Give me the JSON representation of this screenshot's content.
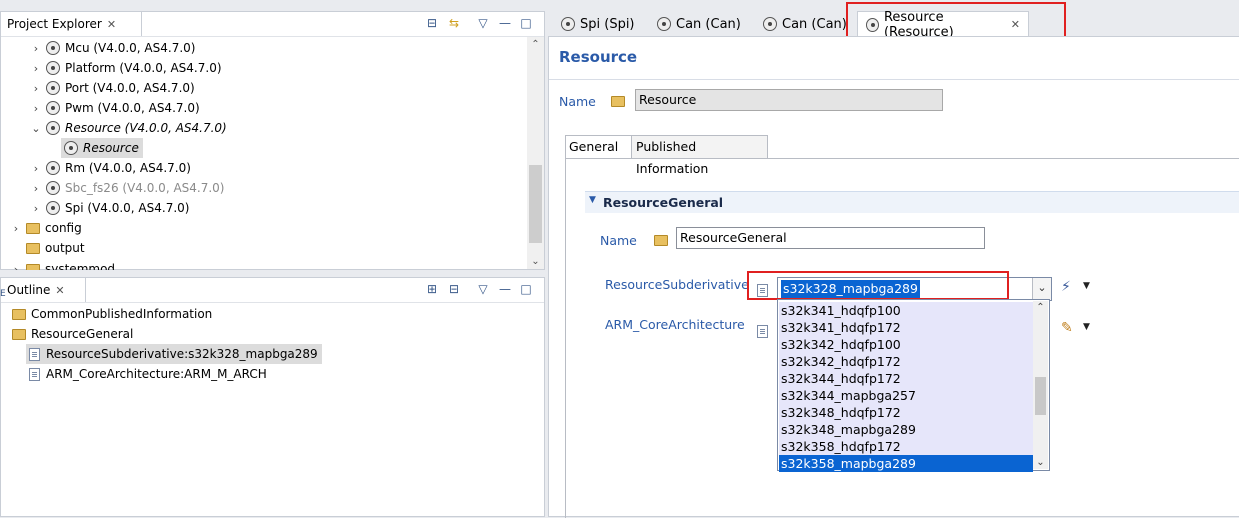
{
  "project_explorer": {
    "tab_label": "Project Explorer",
    "tree": [
      {
        "label": "Mcu (V4.0.0, AS4.7.0)",
        "icon": "module-icon",
        "style": "normal"
      },
      {
        "label": "Platform (V4.0.0, AS4.7.0)",
        "icon": "module-icon",
        "style": "normal"
      },
      {
        "label": "Port (V4.0.0, AS4.7.0)",
        "icon": "module-icon",
        "style": "normal"
      },
      {
        "label": "Pwm (V4.0.0, AS4.7.0)",
        "icon": "module-icon",
        "style": "normal"
      },
      {
        "label": "Resource (V4.0.0, AS4.7.0)",
        "icon": "module-icon",
        "style": "italic"
      },
      {
        "label": "Resource",
        "icon": "module-icon",
        "style": "italic"
      },
      {
        "label": "Rm (V4.0.0, AS4.7.0)",
        "icon": "module-icon",
        "style": "normal"
      },
      {
        "label": "Sbc_fs26 (V4.0.0, AS4.7.0)",
        "icon": "module-icon",
        "style": "grey"
      },
      {
        "label": "Spi (V4.0.0, AS4.7.0)",
        "icon": "module-icon",
        "style": "normal"
      },
      {
        "label": "config",
        "icon": "folder-icon",
        "style": "normal"
      },
      {
        "label": "output",
        "icon": "folder-icon",
        "style": "normal"
      },
      {
        "label": "systemmod",
        "icon": "folder-icon",
        "style": "normal"
      }
    ]
  },
  "outline": {
    "tab_label": "Outline",
    "items": [
      {
        "label": "CommonPublishedInformation",
        "icon": "folder-icon"
      },
      {
        "label": "ResourceGeneral",
        "icon": "folder-icon"
      },
      {
        "label": "ResourceSubderivative:s32k328_mapbga289",
        "icon": "document-icon"
      },
      {
        "label": "ARM_CoreArchitecture:ARM_M_ARCH",
        "icon": "document-icon"
      }
    ]
  },
  "editor_tabs": [
    {
      "label": "Spi (Spi)"
    },
    {
      "label": "Can (Can)"
    },
    {
      "label": "Can (Can)"
    },
    {
      "label": "Resource (Resource)"
    }
  ],
  "editor": {
    "title": "Resource",
    "name_label": "Name",
    "name_value": "Resource",
    "subtabs": [
      "General",
      "Published Information"
    ],
    "section_title": "ResourceGeneral",
    "section_name_label": "Name",
    "section_name_value": "ResourceGeneral",
    "subderivative_label": "ResourceSubderivative",
    "subderivative_value": "s32k328_mapbga289",
    "core_arch_label": "ARM_CoreArchitecture",
    "dropdown_options": [
      "s32k341_hdqfp100",
      "s32k341_hdqfp172",
      "s32k342_hdqfp100",
      "s32k342_hdqfp172",
      "s32k344_hdqfp172",
      "s32k344_mapbga257",
      "s32k348_hdqfp172",
      "s32k348_mapbga289",
      "s32k358_hdqfp172",
      "s32k358_mapbga289"
    ],
    "dropdown_selected_index": 9
  },
  "colors": {
    "accent": "#2a5aa8",
    "selection": "#0a64d2",
    "highlight_box": "#e02020"
  }
}
